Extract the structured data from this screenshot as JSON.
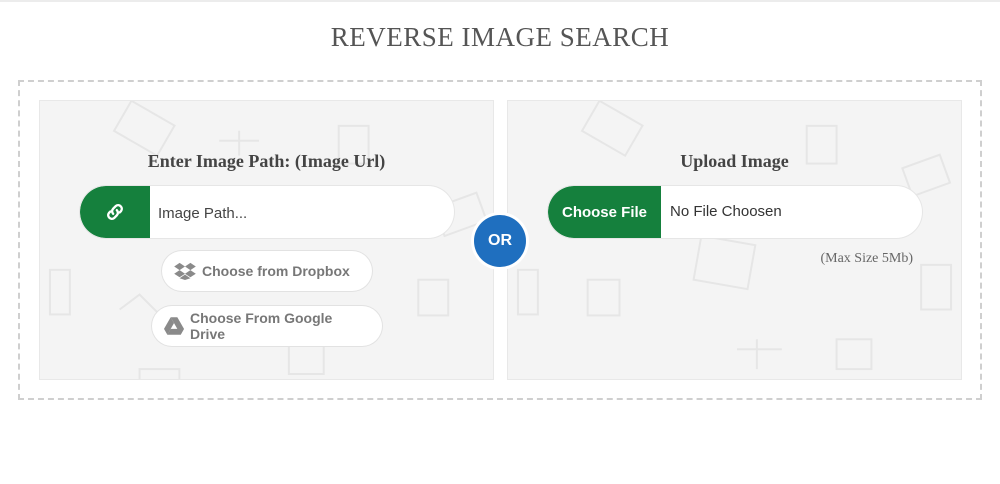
{
  "page": {
    "title": "REVERSE IMAGE SEARCH"
  },
  "url_panel": {
    "heading": "Enter Image Path: (Image Url)",
    "input_placeholder": "Image Path...",
    "link_icon": "link-icon",
    "dropbox_label": "Choose from Dropbox",
    "dropbox_icon": "dropbox-icon",
    "gdrive_label": "Choose From Google Drive",
    "gdrive_icon": "google-drive-icon"
  },
  "separator": {
    "label": "OR"
  },
  "upload_panel": {
    "heading": "Upload Image",
    "choose_file_label": "Choose File",
    "file_status": "No File Choosen",
    "max_size_note": "(Max Size 5Mb)"
  },
  "colors": {
    "accent_green": "#15803d",
    "or_blue": "#1f6fbf",
    "panel_bg": "#f4f4f4",
    "dashed_border": "#cfcfcf"
  }
}
